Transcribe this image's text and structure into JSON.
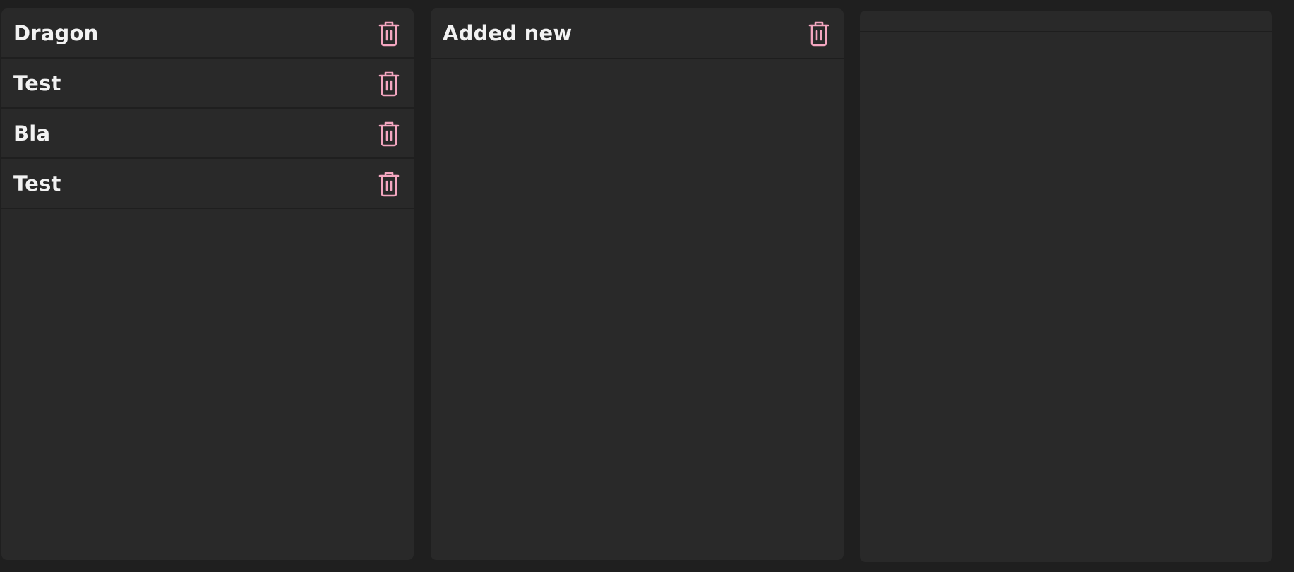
{
  "colors": {
    "background": "#1f1f1f",
    "column": "#292929",
    "text": "#f2f2f2",
    "delete_icon": "#f4a6c0"
  },
  "columns": [
    {
      "items": [
        {
          "label": "Dragon",
          "icon": "trash-icon"
        },
        {
          "label": "Test",
          "icon": "trash-icon"
        },
        {
          "label": "Bla",
          "icon": "trash-icon"
        },
        {
          "label": "Test",
          "icon": "trash-icon"
        }
      ]
    },
    {
      "items": [
        {
          "label": "Added new",
          "icon": "trash-icon"
        }
      ]
    },
    {
      "items": []
    }
  ]
}
